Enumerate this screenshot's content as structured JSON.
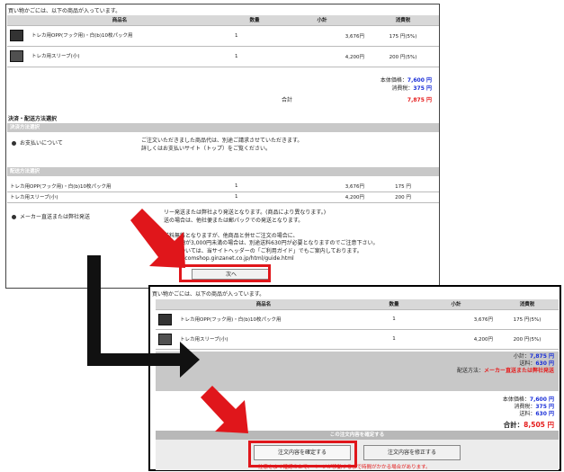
{
  "panel1": {
    "caption": "買い物かごには、以下の商品が入っています。",
    "headers": [
      "商品名",
      "数量",
      "小計",
      "消費税"
    ],
    "items": [
      {
        "name": "トレカ用OPP(フック用)・白(b)10枚パック用",
        "qty": "1",
        "subtotal": "3,676円",
        "tax": "175 円(5%)"
      },
      {
        "name": "トレカ用スリーブ(小)",
        "qty": "1",
        "subtotal": "4,200円",
        "tax": "200 円(5%)"
      }
    ],
    "price_label": "本体価格：",
    "price_value": "7,600 円",
    "tax_label": "消費税：",
    "tax_value": "375 円",
    "total_label": "合計",
    "total_value": "7,875 円",
    "settlement_title": "決済・配送方法選択",
    "payment_bar": "決済方法選択",
    "payment_option": "お支払いについて",
    "payment_note_1": "ご注文いただきました商品代は、別途ご請求させていただきます。",
    "payment_note_2": "詳しくはお支払いサイト（トップ）をご覧ください。",
    "shipping_bar": "配送方法選択",
    "ship_items": [
      {
        "name": "トレカ用OPP(フック用)・白(b)10枚パック用",
        "qty": "1",
        "subtotal": "3,676円",
        "tax": "175 円"
      },
      {
        "name": "トレカ用スリーブ(小)",
        "qty": "1",
        "subtotal": "4,200円",
        "tax": "200 円"
      }
    ],
    "ship_option": "メーカー直送または弊社発送",
    "ship_note_1": "リー発送または弊社より発送となります。(商品により異なります。)",
    "ship_note_2": "送の場合は、他社便または郵パックでの発送となります。",
    "ship_note_3": "送料無料となりますが、他商品と併せご注文の場合に、",
    "ship_note_4": "請求金額が3,000円未満の場合は、別途送料630円が必要となりますのでご注意下さい。",
    "ship_note_5": "配送については、当サイトヘッダーの「ご利用ガイド」でもご案内しております。",
    "ship_link": "→http://comshop.ginzanet.co.jp/html/guide.html",
    "next_button": "次へ"
  },
  "panel2": {
    "caption": "買い物かごには、以下の商品が入っています。",
    "headers": [
      "商品名",
      "数量",
      "小計",
      "消費税"
    ],
    "items": [
      {
        "name": "トレカ用OPP(フック用)・白(b)10枚パック用",
        "qty": "1",
        "subtotal": "3,676円",
        "tax": "175 円(5%)"
      },
      {
        "name": "トレカ用スリーブ(小)",
        "qty": "1",
        "subtotal": "4,200円",
        "tax": "200 円(5%)"
      }
    ],
    "subtotal_label": "小計：",
    "subtotal_value": "7,875 円",
    "shipping_label": "送料：",
    "shipping_value": "630 円",
    "method_label": "配送方法：",
    "method_value": "メーカー直送または弊社発送",
    "price_label": "本体価格：",
    "price_value": "7,600 円",
    "tax_label": "消費税：",
    "tax_value": "375 円",
    "fee_label": "送料：",
    "fee_value": "630 円",
    "total_label": "合計：",
    "total_value": "8,505 円",
    "confirm_bar": "この注文内容を確定する",
    "confirm_button": "注文内容を確定する",
    "modify_button": "注文内容を修正する",
    "warning": "注意をよく確認の上で、ページが移動するまで時間がかかる場合があります。"
  },
  "colors": {
    "highlight": "#e0161b",
    "arrow_red": "#e0161b",
    "blue": "#1a2fd8",
    "red": "#e51b1b"
  }
}
